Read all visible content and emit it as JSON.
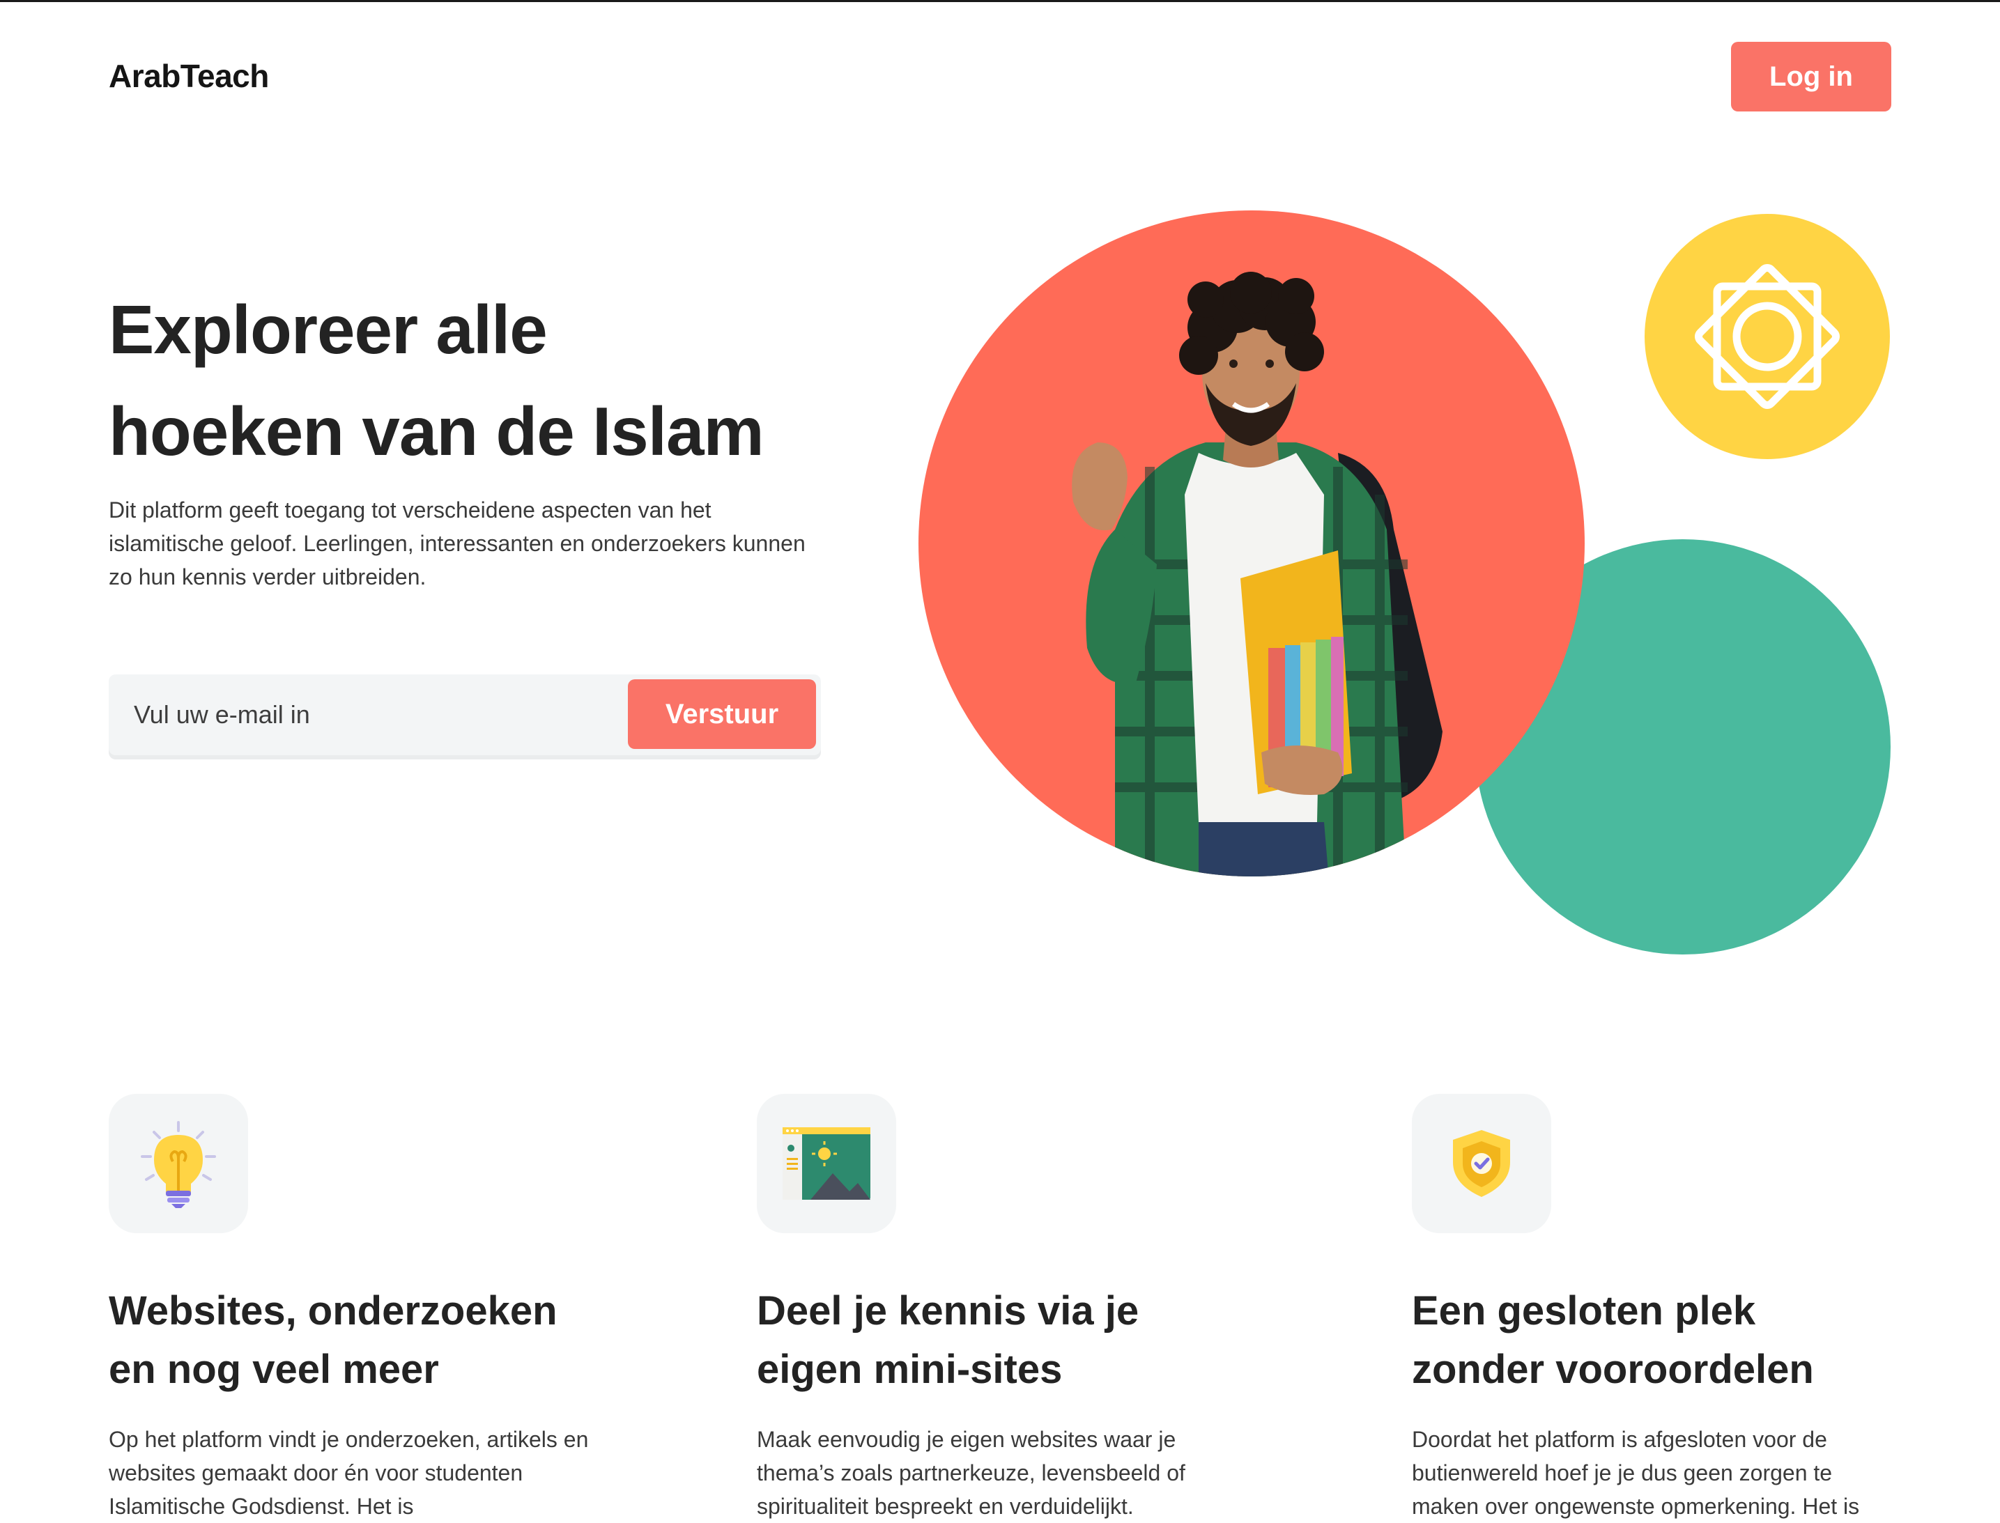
{
  "header": {
    "logo": "ArabTeach",
    "login_label": "Log in"
  },
  "hero": {
    "title_line1": "Exploreer alle",
    "title_line2": "hoeken van de Islam",
    "description": "Dit platform geeft toegang tot verscheidene aspecten van het islamitische geloof. Leerlingen, interessanten en onderzoekers kunnen zo hun kennis verder uitbreiden.",
    "email_placeholder": "Vul uw e-mail in",
    "submit_label": "Verstuur"
  },
  "features": [
    {
      "icon": "lightbulb-icon",
      "title": "Websites, onderzoeken en nog veel meer",
      "text": "Op het platform vindt je onderzoeken, artikels en websites gemaakt door én voor studenten Islamitische Godsdienst. Het is"
    },
    {
      "icon": "website-image-icon",
      "title": "Deel je kennis via je eigen mini-sites",
      "text": "Maak eenvoudig je eigen websites waar je thema’s zoals partnerkeuze, levensbeeld of spiritualiteit bespreekt en verduidelijkt."
    },
    {
      "icon": "shield-check-icon",
      "title": "Een gesloten plek zonder vooroordelen",
      "text": "Doordat het platform is afgesloten voor de butienwereld hoef je je dus geen zorgen te maken over ongewenste opmerkening. Het is"
    }
  ],
  "colors": {
    "accent": "#fa7367",
    "coral_circle": "#ff6b57",
    "yellow_circle": "#ffd444",
    "green_circle": "#4aba9e",
    "icon_bg": "#f3f5f6"
  }
}
